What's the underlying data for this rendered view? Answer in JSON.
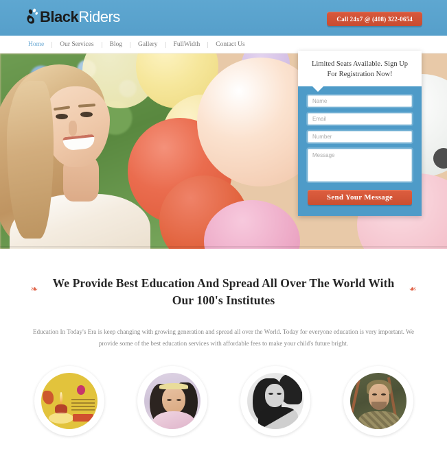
{
  "header": {
    "logo": {
      "icon": "paw-print-icon",
      "text_primary": "Black",
      "text_secondary": "Riders"
    },
    "call_button": {
      "label": "Call 24x7 @ (408) 322-0654",
      "color": "#cb4f32"
    },
    "background_color": "#5ba4cf"
  },
  "nav": {
    "items": [
      {
        "label": "Home",
        "active": true
      },
      {
        "label": "Our Services",
        "active": false
      },
      {
        "label": "Blog",
        "active": false
      },
      {
        "label": "Gallery",
        "active": false
      },
      {
        "label": "FullWidth",
        "active": false
      },
      {
        "label": "Contact Us",
        "active": false
      }
    ],
    "active_color": "#6aa9d4",
    "inactive_color": "#777777"
  },
  "hero": {
    "alt": "smiling blonde woman holding colorful balloons outdoors"
  },
  "signup_form": {
    "heading": "Limited Seats Available. Sign Up For Registration Now!",
    "panel_color": "#4e9bc8",
    "fields": [
      {
        "name": "name",
        "placeholder": "Name",
        "value": ""
      },
      {
        "name": "email",
        "placeholder": "Email",
        "value": ""
      },
      {
        "name": "number",
        "placeholder": "Number",
        "value": ""
      }
    ],
    "message": {
      "placeholder": "Message",
      "value": ""
    },
    "submit_label": "Send Your Message",
    "submit_color": "#cb4f32"
  },
  "section": {
    "title": "We Provide Best Education And Spread All Over The World With Our 100's Institutes",
    "ornament": "❧",
    "ornament_color": "#e0654a",
    "body": "Education In Today's Era is keep changing with growing generation and spread all over the World. Today for everyone education is very important. We provide some of the best education services with affordable fees to make your child's future bright."
  },
  "gallery": {
    "items": [
      {
        "name": "circle-thumb-1",
        "alt": "yellow festival flyer with oil lamp"
      },
      {
        "name": "circle-thumb-2",
        "alt": "young girl with headband in winter coat"
      },
      {
        "name": "circle-thumb-3",
        "alt": "black and white portrait of woman"
      },
      {
        "name": "circle-thumb-4",
        "alt": "man in olive green outdoor setting"
      }
    ]
  }
}
